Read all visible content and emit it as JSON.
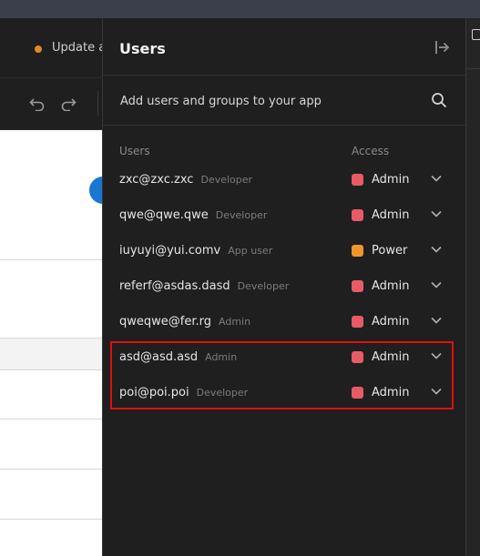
{
  "background": {
    "status_text": "Update a"
  },
  "panel": {
    "title": "Users",
    "search_placeholder": "Add users and groups to your app",
    "columns": {
      "users": "Users",
      "access": "Access"
    },
    "rows": [
      {
        "email": "zxc@zxc.zxc",
        "role": "Developer",
        "access": "Admin",
        "color": "#e85b66"
      },
      {
        "email": "qwe@qwe.qwe",
        "role": "Developer",
        "access": "Admin",
        "color": "#e85b66"
      },
      {
        "email": "iuyuyi@yui.comv",
        "role": "App user",
        "access": "Power",
        "color": "#f0952c"
      },
      {
        "email": "referf@asdas.dasd",
        "role": "Developer",
        "access": "Admin",
        "color": "#e85b66"
      },
      {
        "email": "qweqwe@fer.rg",
        "role": "Admin",
        "access": "Admin",
        "color": "#e85b66"
      },
      {
        "email": "asd@asd.asd",
        "role": "Admin",
        "access": "Admin",
        "color": "#e85b66"
      },
      {
        "email": "poi@poi.poi",
        "role": "Developer",
        "access": "Admin",
        "color": "#e85b66"
      }
    ]
  },
  "colors": {
    "admin": "#e85b66",
    "power": "#f0952c",
    "highlight": "#e01010"
  }
}
